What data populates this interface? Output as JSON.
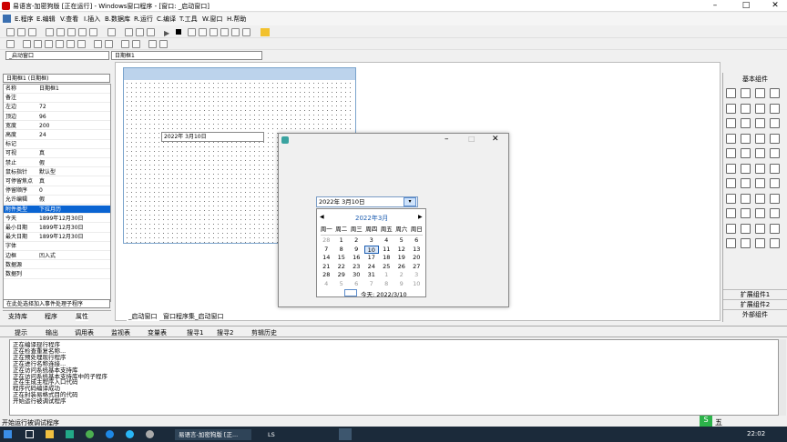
{
  "window": {
    "title": "易语言-加密狗版 [正在运行] - Windows窗口程序 - [窗口: _启动窗口]"
  },
  "menu": [
    "E.程序",
    "E.编辑",
    "V.查看",
    "I.插入",
    "B.数据库",
    "R.运行",
    "C.编译",
    "T.工具",
    "W.窗口",
    "H.帮助"
  ],
  "combos": {
    "window_combo": "_启动窗口",
    "object_combo": "日期框1",
    "prop_object": "日期框1 (日期框)"
  },
  "properties": [
    {
      "k": "名称",
      "v": "日期框1"
    },
    {
      "k": "备注",
      "v": ""
    },
    {
      "k": "左边",
      "v": "72"
    },
    {
      "k": "顶边",
      "v": "96"
    },
    {
      "k": "宽度",
      "v": "200"
    },
    {
      "k": "高度",
      "v": "24"
    },
    {
      "k": "标记",
      "v": ""
    },
    {
      "k": "可视",
      "v": "真"
    },
    {
      "k": "禁止",
      "v": "假"
    },
    {
      "k": "鼠标指针",
      "v": "默认型"
    },
    {
      "k": "可停留焦点",
      "v": "真"
    },
    {
      "k": "停留顺序",
      "v": "0"
    },
    {
      "k": "允许编辑",
      "v": "假"
    },
    {
      "k": "附件类型",
      "v": "下拉月历",
      "sel": true
    },
    {
      "k": "今天",
      "v": "1899年12月30日"
    },
    {
      "k": "最小日期",
      "v": "1899年12月30日"
    },
    {
      "k": "最大日期",
      "v": "1899年12月30日"
    },
    {
      "k": "字体",
      "v": ""
    },
    {
      "k": "边框",
      "v": "凹入式"
    },
    {
      "k": "数据源",
      "v": ""
    },
    {
      "k": "数据列",
      "v": ""
    }
  ],
  "event_combo": "在此处选择加入事件处理子程序",
  "left_tabs": [
    "支持库",
    "程序",
    "属性"
  ],
  "editor_tabs": [
    "_启动窗口",
    "窗口程序集_启动窗口"
  ],
  "design_date": "2022年 3月10日",
  "run_date": "2022年 3月10日",
  "calendar": {
    "month": "2022年3月",
    "weekdays": [
      "周一",
      "周二",
      "周三",
      "周四",
      "周五",
      "周六",
      "周日"
    ],
    "rows": [
      [
        {
          "d": "28",
          "g": true
        },
        {
          "d": "1"
        },
        {
          "d": "2"
        },
        {
          "d": "3"
        },
        {
          "d": "4"
        },
        {
          "d": "5"
        },
        {
          "d": "6"
        }
      ],
      [
        {
          "d": "7"
        },
        {
          "d": "8"
        },
        {
          "d": "9"
        },
        {
          "d": "10",
          "today": true
        },
        {
          "d": "11"
        },
        {
          "d": "12"
        },
        {
          "d": "13"
        }
      ],
      [
        {
          "d": "14"
        },
        {
          "d": "15"
        },
        {
          "d": "16"
        },
        {
          "d": "17"
        },
        {
          "d": "18"
        },
        {
          "d": "19"
        },
        {
          "d": "20"
        }
      ],
      [
        {
          "d": "21"
        },
        {
          "d": "22"
        },
        {
          "d": "23"
        },
        {
          "d": "24"
        },
        {
          "d": "25"
        },
        {
          "d": "26"
        },
        {
          "d": "27"
        }
      ],
      [
        {
          "d": "28"
        },
        {
          "d": "29"
        },
        {
          "d": "30"
        },
        {
          "d": "31"
        },
        {
          "d": "1",
          "g": true
        },
        {
          "d": "2",
          "g": true
        },
        {
          "d": "3",
          "g": true
        }
      ],
      [
        {
          "d": "4",
          "g": true
        },
        {
          "d": "5",
          "g": true
        },
        {
          "d": "6",
          "g": true
        },
        {
          "d": "7",
          "g": true
        },
        {
          "d": "8",
          "g": true
        },
        {
          "d": "9",
          "g": true
        },
        {
          "d": "10",
          "g": true
        }
      ]
    ],
    "today_label": "今天: 2022/3/10"
  },
  "right_panel": {
    "title": "基本组件",
    "bottom": [
      "扩展组件1",
      "扩展组件2",
      "外部组件"
    ]
  },
  "output_tabs": [
    "提示",
    "输出",
    "调用表",
    "监视表",
    "变量表",
    "搜寻1",
    "搜寻2",
    "剪辑历史"
  ],
  "output_lines": [
    "正在编译现行程序",
    "正在检查重复名称...",
    "正在预处理现行程序",
    "正在进行名称连接...",
    "正在访问系统基本支持库",
    "正在访问系统基本支持库中的子程序",
    "正在生成主程序入口代码",
    "程序代码编译成功",
    "正在封装易格式目的代码",
    "开始运行被调试程序"
  ],
  "status": "开始运行被调试程序",
  "taskbar": {
    "items": [
      "易语言-加密狗版 [正...",
      "LS"
    ],
    "ime": "五",
    "time": "22:02"
  }
}
